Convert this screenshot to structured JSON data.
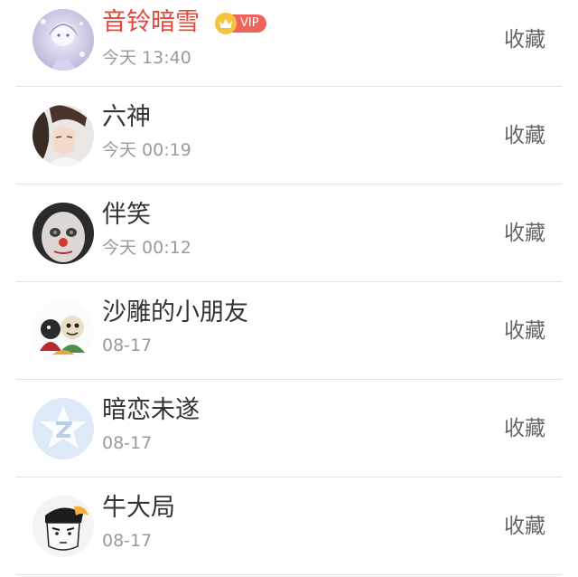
{
  "friends": [
    {
      "name": "音铃暗雪",
      "time": "今天 13:40",
      "vip": true,
      "vip_label": "VIP",
      "action": "收藏",
      "avatar_icon": "anime-girl-avatar"
    },
    {
      "name": "六神",
      "time": "今天 00:19",
      "action": "收藏",
      "avatar_icon": "person-avatar"
    },
    {
      "name": "伴笑",
      "time": "今天 00:12",
      "action": "收藏",
      "avatar_icon": "clown-face-avatar"
    },
    {
      "name": "沙雕的小朋友",
      "time": "08-17",
      "action": "收藏",
      "avatar_icon": "cartoon-characters-avatar"
    },
    {
      "name": "暗恋未遂",
      "time": "08-17",
      "action": "收藏",
      "avatar_icon": "default-qq-avatar"
    },
    {
      "name": "牛大局",
      "time": "08-17",
      "action": "收藏",
      "avatar_icon": "cartoon-man-avatar"
    }
  ],
  "colors": {
    "vip_name": "#e5483a",
    "name": "#333333",
    "time": "#9a9a9a",
    "action": "#666666",
    "vip_tag": "#f0635b",
    "crown": "#f6c33f"
  }
}
